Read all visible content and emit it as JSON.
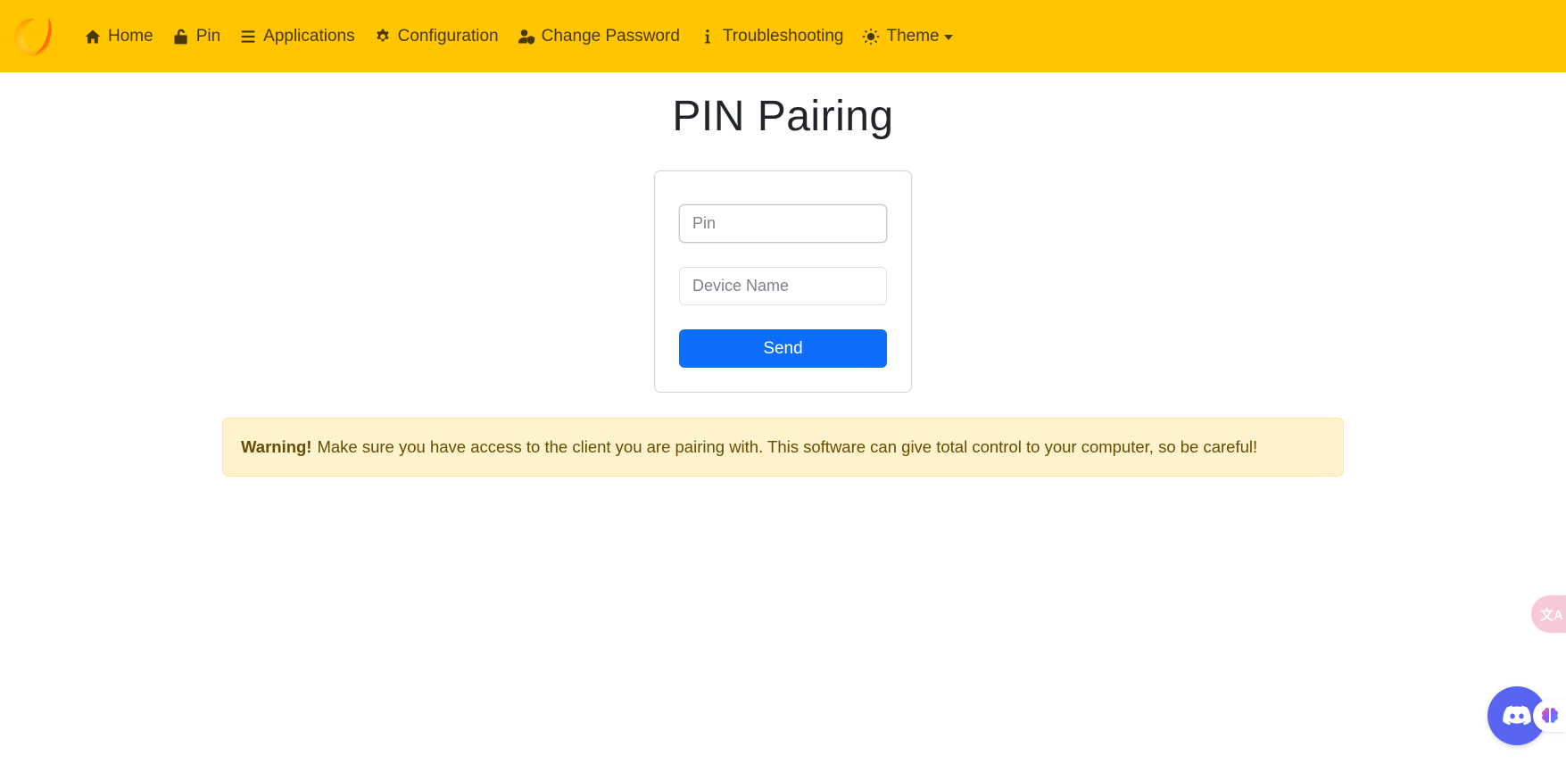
{
  "colors": {
    "navbar_bg": "#ffc600",
    "nav_text": "#4a3a00",
    "primary_button": "#0d6efd",
    "alert_bg": "#fff3cd",
    "alert_text": "#664d03"
  },
  "navbar": {
    "brand_icon": "sunshine-logo",
    "items": [
      {
        "label": "Home",
        "icon": "home-icon"
      },
      {
        "label": "Pin",
        "icon": "unlock-icon"
      },
      {
        "label": "Applications",
        "icon": "list-icon"
      },
      {
        "label": "Configuration",
        "icon": "gear-icon"
      },
      {
        "label": "Change Password",
        "icon": "user-shield-icon"
      },
      {
        "label": "Troubleshooting",
        "icon": "info-icon"
      },
      {
        "label": "Theme",
        "icon": "theme-gear-icon"
      }
    ]
  },
  "page": {
    "title": "PIN Pairing"
  },
  "form": {
    "pin_placeholder": "Pin",
    "pin_value": "",
    "device_name_placeholder": "Device Name",
    "device_name_value": "",
    "send_label": "Send"
  },
  "alert": {
    "strong": "Warning!",
    "message": "Make sure you have access to the client you are pairing with. This software can give total control to your computer, so be careful!"
  },
  "widgets": {
    "translate_label": "文A",
    "discord_icon": "discord-icon",
    "ai_icon": "brain-icon"
  }
}
